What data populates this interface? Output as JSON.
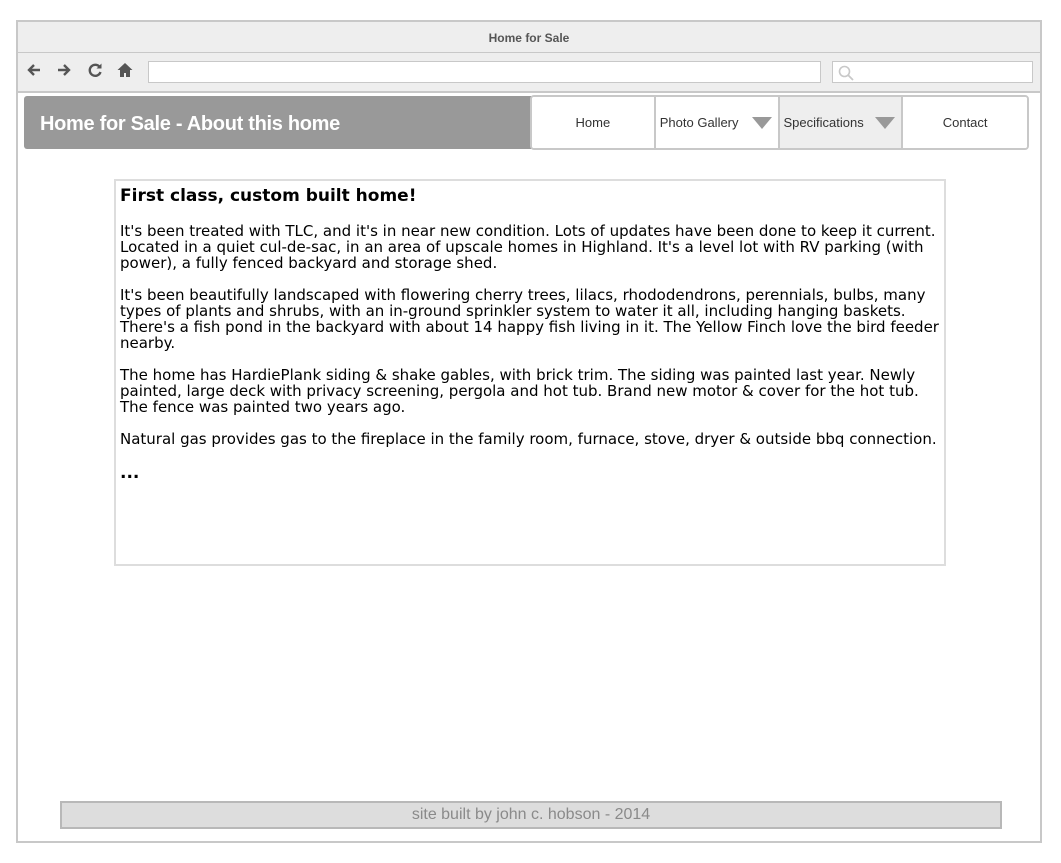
{
  "window": {
    "title": "Home for Sale"
  },
  "toolbar": {
    "back_icon": "arrow-left-icon",
    "forward_icon": "arrow-right-icon",
    "reload_icon": "reload-icon",
    "home_icon": "home-icon",
    "search_icon": "search-icon",
    "url_value": "",
    "search_value": ""
  },
  "header": {
    "title": "Home for Sale - About this home"
  },
  "nav": {
    "items": [
      {
        "label": "Home",
        "has_dropdown": false
      },
      {
        "label": "Photo Gallery",
        "has_dropdown": true
      },
      {
        "label": "Specifications",
        "has_dropdown": true,
        "active": true
      },
      {
        "label": "Contact",
        "has_dropdown": false
      }
    ]
  },
  "content": {
    "heading": "First class, custom built home!",
    "paragraphs": [
      "It's been treated with TLC, and it's in near new condition. Lots of updates have been done to keep it current. Located in a quiet cul-de-sac, in an area of upscale homes in Highland. It's a level lot with RV parking (with power), a fully fenced backyard and storage shed.",
      "It's been beautifully landscaped with flowering cherry trees, lilacs, rhododendrons, perennials, bulbs, many types of plants and shrubs, with an in-ground sprinkler system to water it all, including hanging baskets. There's a fish pond in the backyard with about 14 happy fish living in it. The Yellow Finch love the bird feeder nearby.",
      "The home has HardiePlank siding & shake gables, with brick trim. The siding was painted last year. Newly painted, large deck with privacy screening, pergola and hot tub. Brand new motor & cover for the hot tub. The fence was painted two years ago.",
      "Natural gas provides gas to the fireplace in the family room, furnace, stove, dryer & outside bbq connection."
    ],
    "ellipsis": "..."
  },
  "footer": {
    "text": "site built by john c. hobson - 2014"
  },
  "colors": {
    "banner": "#999999",
    "chrome": "#eeeeee",
    "border": "#c8c8c8",
    "footer_bg": "#dddddd",
    "footer_text": "#8a8a8a"
  }
}
